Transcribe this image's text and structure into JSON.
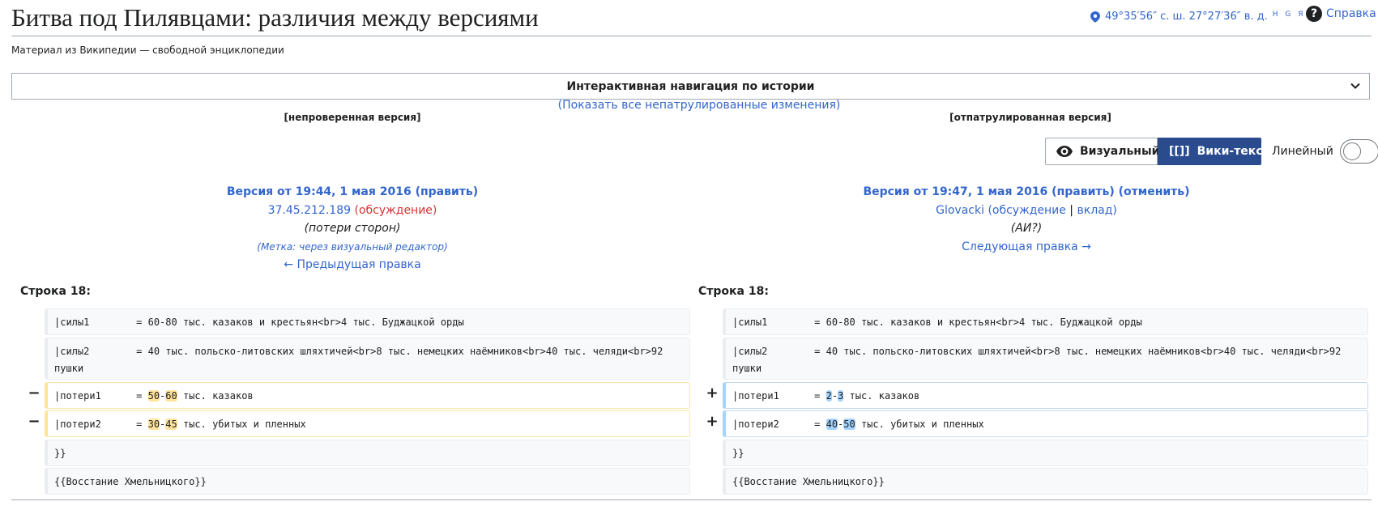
{
  "page": {
    "title": "Битва под Пилявцами: различия между версиями",
    "subtitle": "Материал из Википедии — свободной энциклопедии",
    "coordinates": "49°35′56″ с. ш. 27°27′36″ в. д.",
    "coordinate_flags": "H G Я O",
    "help_label": "Справка",
    "help_glyph": "?"
  },
  "history_nav": {
    "label": "Интерактивная навигация по истории",
    "show_unpatrolled": "(Показать все непатрулированные изменения)"
  },
  "labels": {
    "left_status": "[непроверенная версия]",
    "right_status": "[отпатрулированная версия]"
  },
  "view_modes": {
    "visual": "Визуальный",
    "wikitext": "Вики-текст",
    "linear": "Линейный",
    "wikitext_glyph": "[[]]"
  },
  "left_rev": {
    "version": "Версия от 19:44, 1 мая 2016",
    "edit": "(править)",
    "user": "37.45.212.189",
    "talk_open": "(",
    "talk": "обсуждение",
    "talk_close": ")",
    "summary": "(потери сторон)",
    "tag": "(Метка: через визуальный редактор)",
    "prev": "← Предыдущая правка"
  },
  "right_rev": {
    "version": "Версия от 19:47, 1 мая 2016",
    "edit": "(править)",
    "undo": "(отменить)",
    "user": "Glovacki",
    "talk_open": "(",
    "talk": "обсуждение",
    "sep": " | ",
    "contribs": "вклад",
    "talk_close": ")",
    "summary": "(АИ?)",
    "next": "Следующая правка →"
  },
  "diff": {
    "line_left": "Строка 18:",
    "line_right": "Строка 18:",
    "minus": "−",
    "plus": "+",
    "ctx1": "|силы1        = 60-80 тыс. казаков и крестьян<br>4 тыс. Буджацкой орды",
    "ctx2": "|силы2        = 40 тыс. польско-литовских шляхтичей<br>8 тыс. немецких наёмников<br>40 тыс. челяди<br>92 пушки",
    "del1": {
      "pre": "|потери1      = ",
      "a": "50",
      "mid": "-",
      "b": "60",
      "post": " тыс. казаков"
    },
    "del2": {
      "pre": "|потери2      = ",
      "a": "30",
      "mid": "-",
      "b": "45",
      "post": " тыс. убитых и пленных"
    },
    "add1": {
      "pre": "|потери1      = ",
      "a": "2",
      "mid": "-",
      "b": "3",
      "post": " тыс. казаков"
    },
    "add2": {
      "pre": "|потери2      = ",
      "a": "40",
      "mid": "-",
      "b": "50",
      "post": " тыс. убитых и пленных"
    },
    "ctx3": "}}",
    "ctx4": "{{Восстание Хмельницкого}}"
  },
  "colors": {
    "link": "#3366cc",
    "redlink": "#d73333",
    "wikitext_button": "#2a4b8d",
    "deleted_highlight": "#ffe49c",
    "added_highlight": "#a3d3ff"
  }
}
